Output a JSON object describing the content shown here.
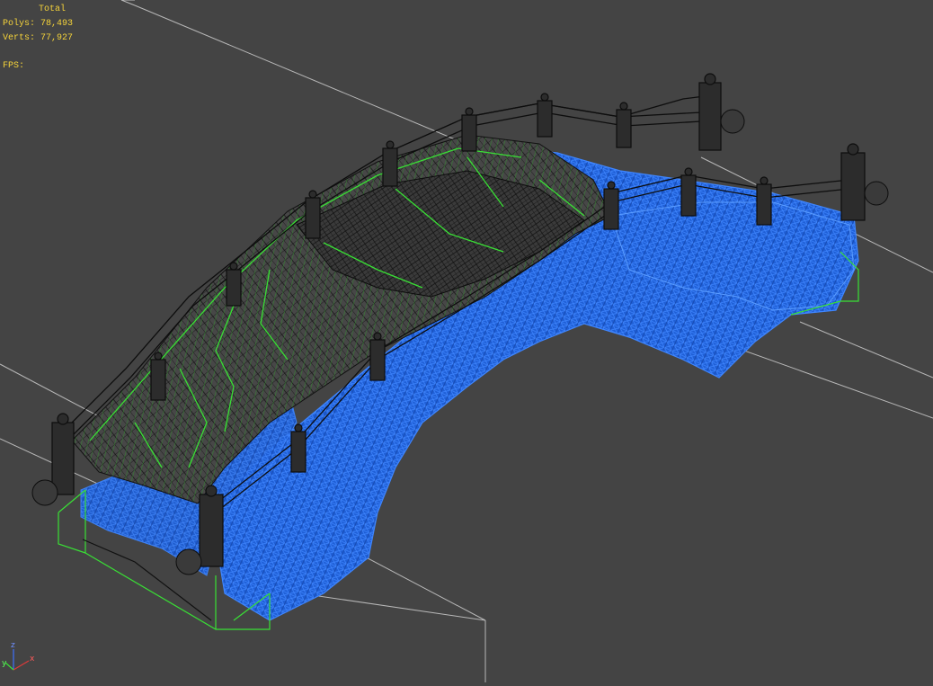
{
  "viewport": {
    "stats": {
      "title": "Total",
      "polys_label": "Polys:",
      "polys_value": "78,493",
      "verts_label": "Verts:",
      "verts_value": "77,927",
      "fps_label": "FPS:"
    },
    "axis_gizmo": {
      "x": "x",
      "y": "y",
      "z": "z"
    },
    "colors": {
      "background": "#444444",
      "grid": "#b8b8b8",
      "stats_text": "#f5d33a",
      "wire_selected": "#2f6fe0",
      "wire_green": "#39e035",
      "wire_black": "#0d0d0d"
    },
    "object": "stone arch bridge wireframe"
  }
}
